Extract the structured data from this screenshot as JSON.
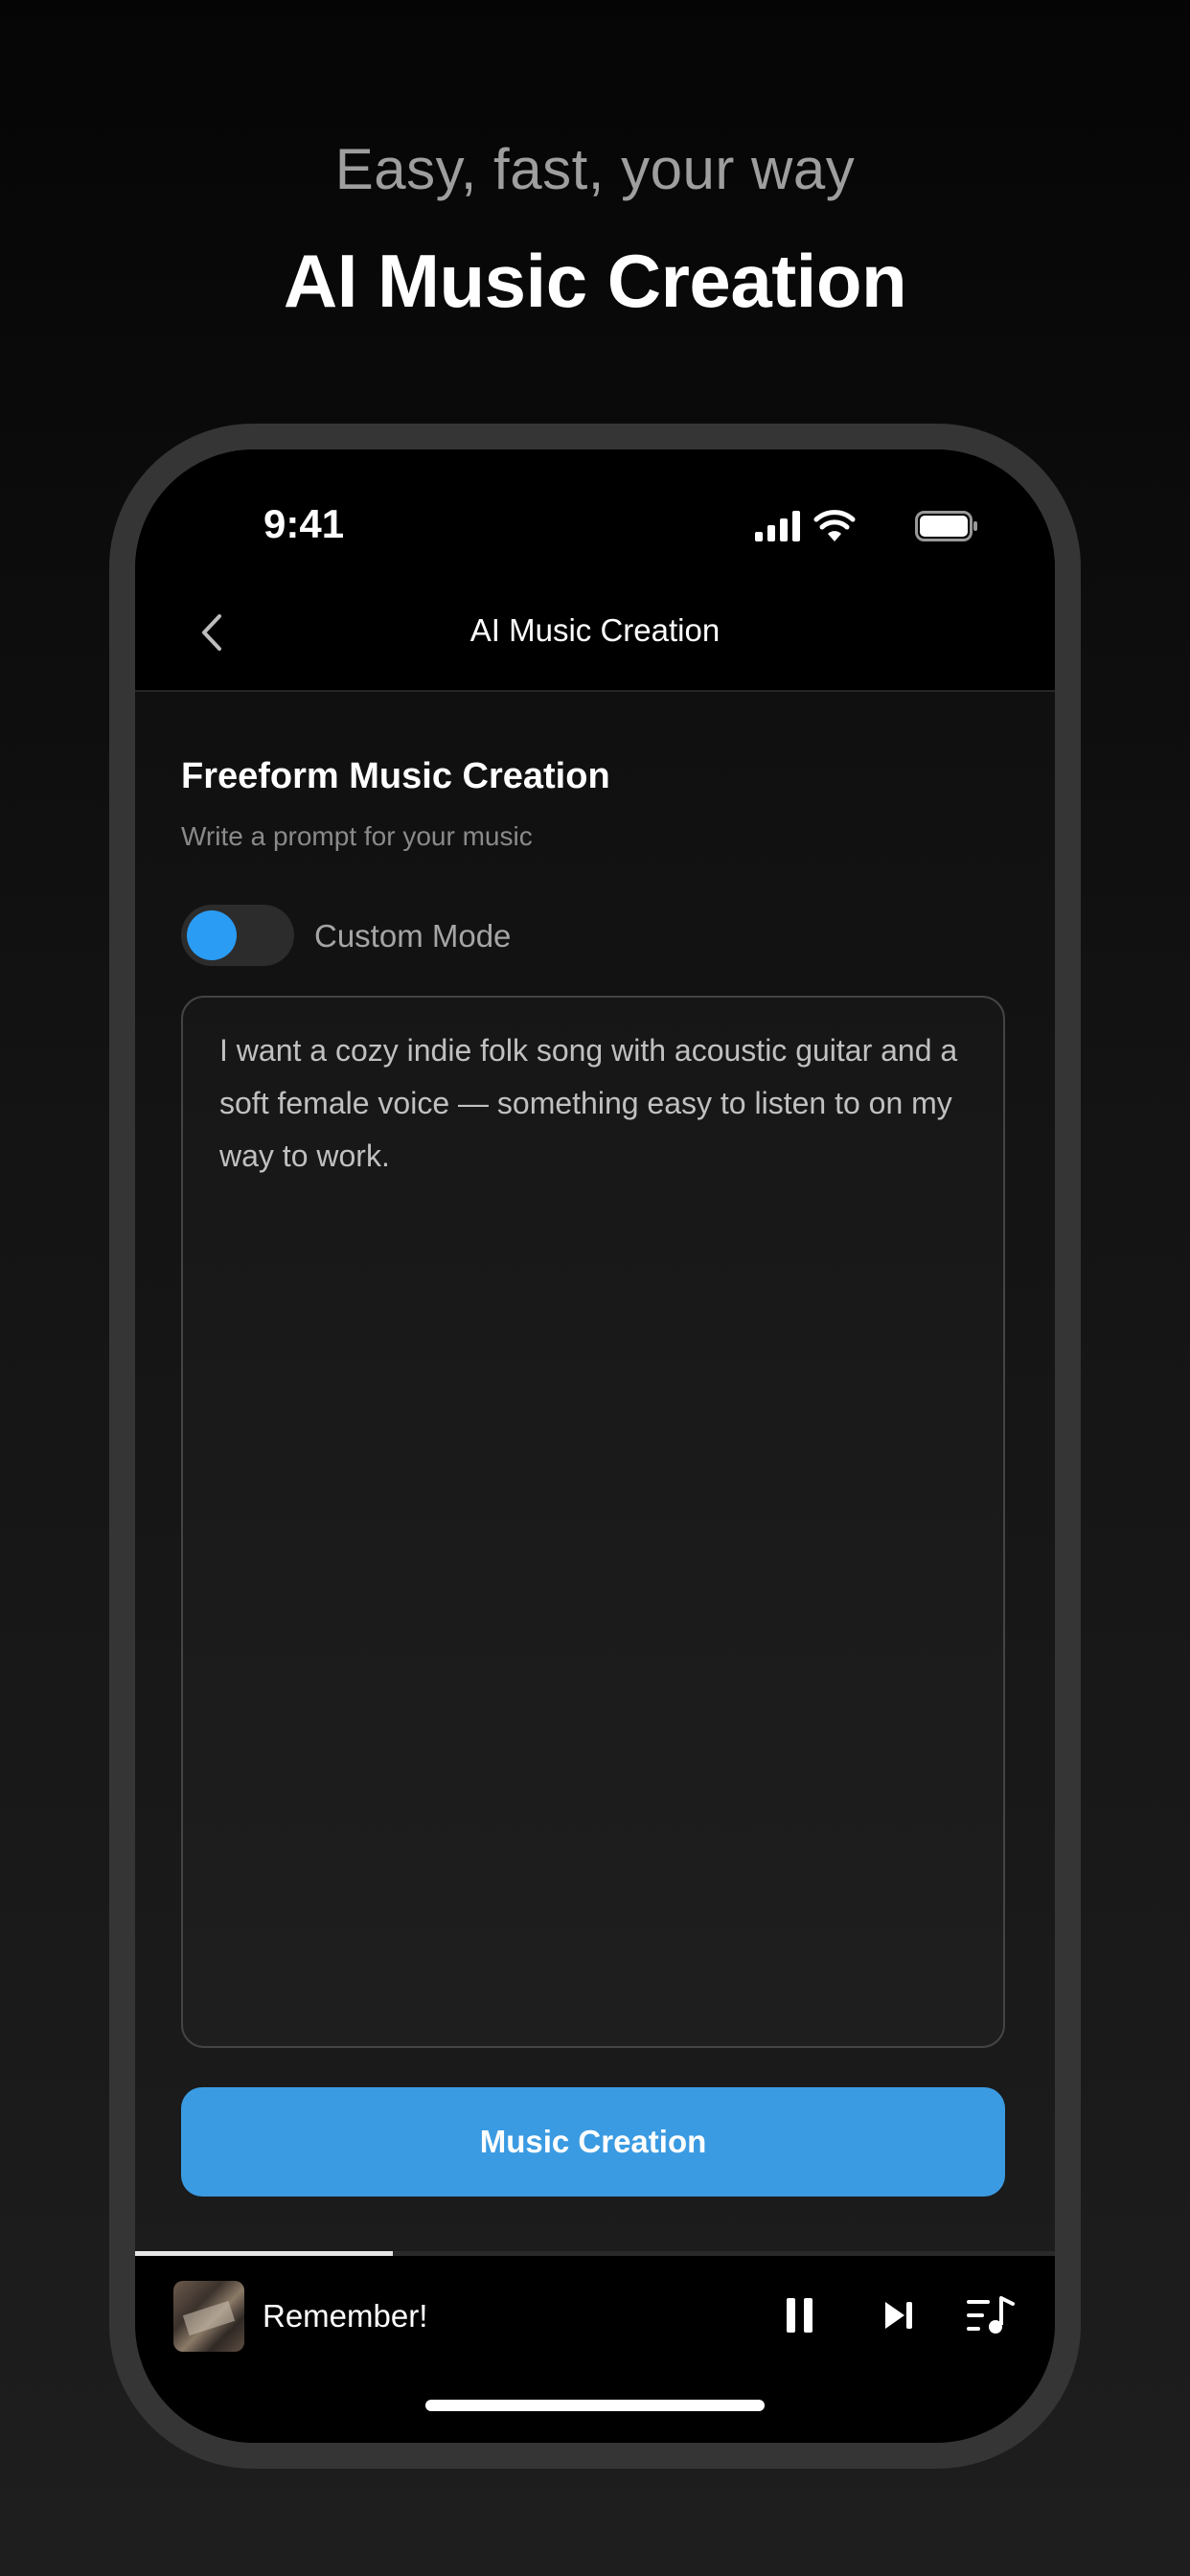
{
  "promo": {
    "tagline": "Easy, fast, your way",
    "headline": "AI Music Creation"
  },
  "status_bar": {
    "time": "9:41",
    "icons": [
      "cellular-signal-icon",
      "wifi-icon",
      "battery-icon"
    ]
  },
  "nav": {
    "title": "AI Music Creation",
    "back_icon": "chevron-left-icon"
  },
  "freeform": {
    "title": "Freeform Music Creation",
    "subtitle": "Write a prompt for your music",
    "custom_mode_label": "Custom Mode",
    "custom_mode_on": false,
    "prompt_text": "I want a cozy indie folk song with acoustic guitar and a soft female voice — something easy to listen to on my way to work.",
    "create_button_label": "Music Creation"
  },
  "player": {
    "track_title": "Remember!",
    "progress": 0.28,
    "controls": [
      "pause-icon",
      "next-icon",
      "queue-icon"
    ]
  },
  "colors": {
    "accent": "#3b9be2",
    "toggle_knob": "#2a9cf4",
    "background": "#000000"
  }
}
